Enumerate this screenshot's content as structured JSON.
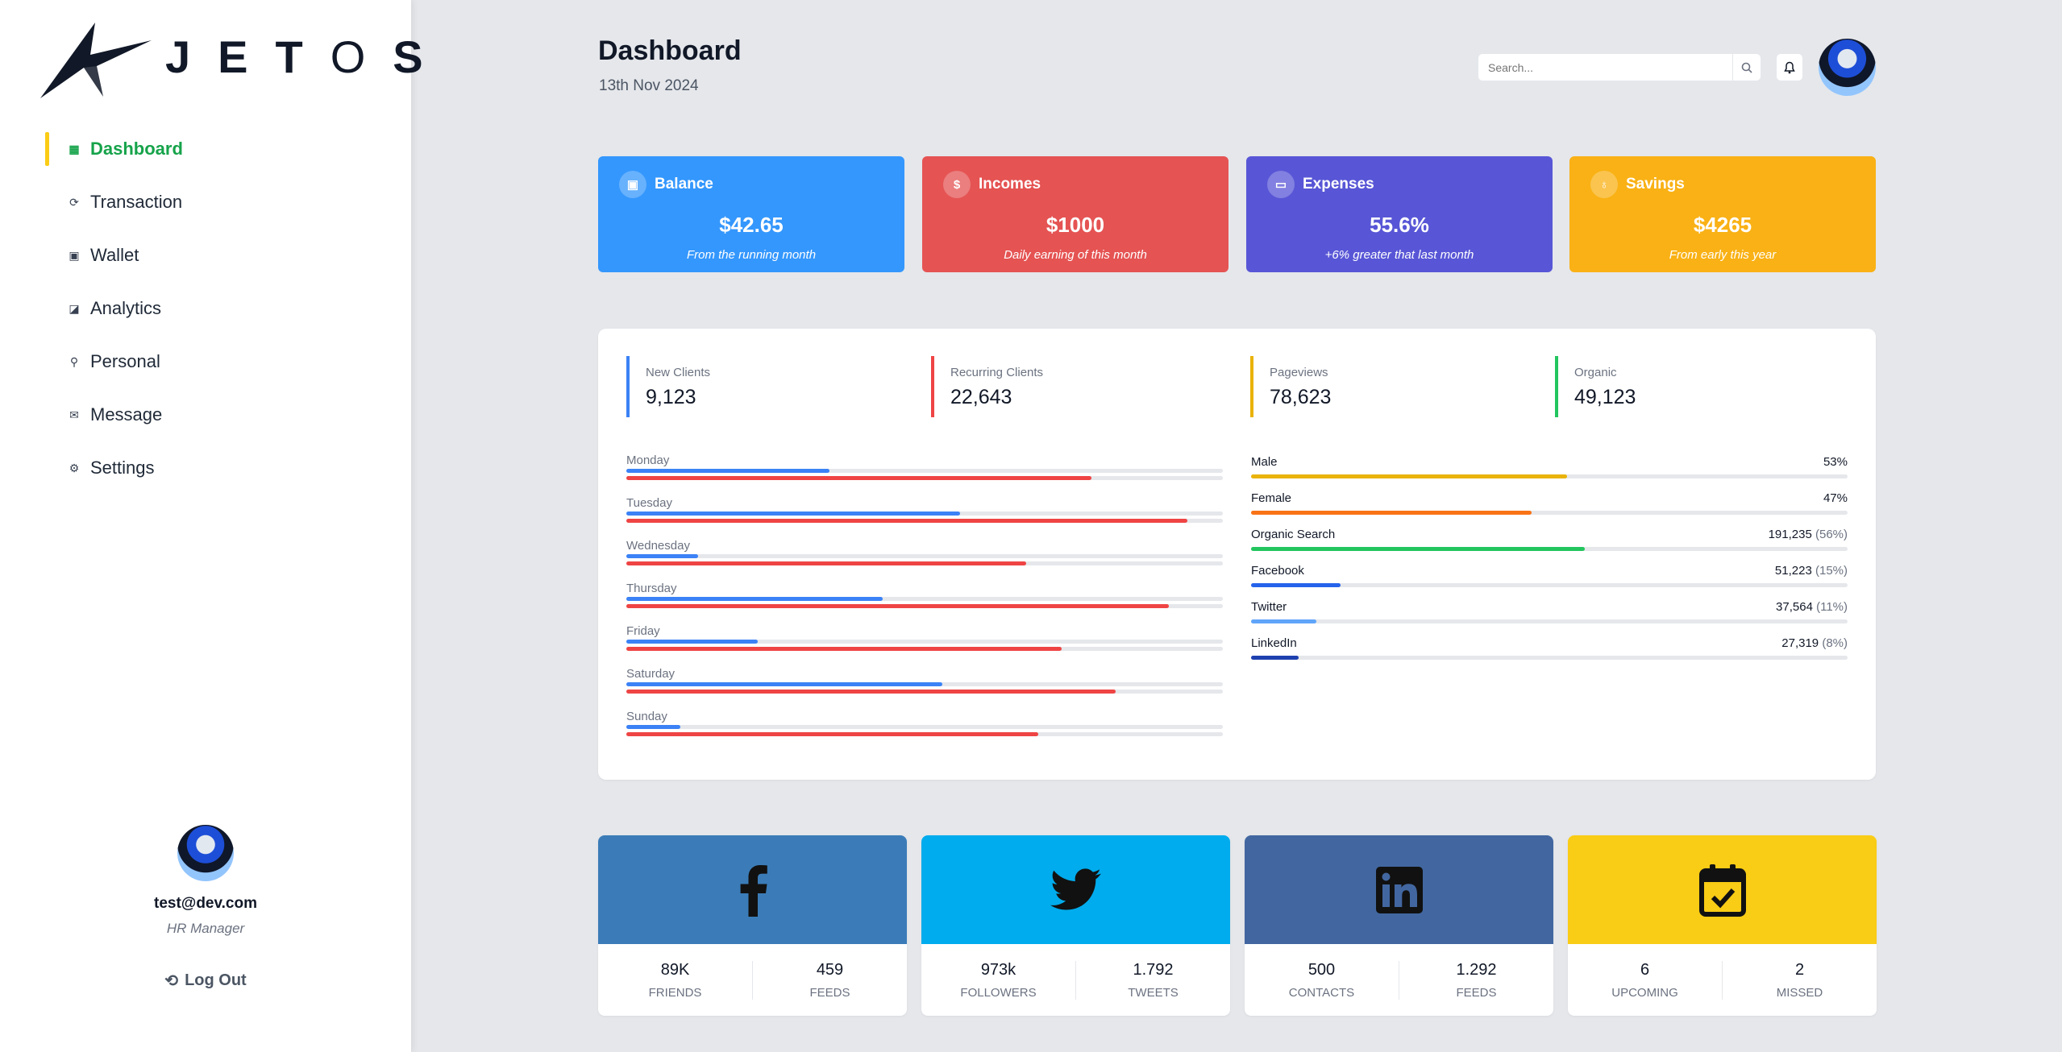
{
  "brand": {
    "name_start": "JET",
    "name_o": "O",
    "name_end": "S"
  },
  "colors": {
    "accent": "#16a34a",
    "active_indicator": "#facc15"
  },
  "sidebar": {
    "items": [
      {
        "label": "Dashboard",
        "icon": "grid-icon"
      },
      {
        "label": "Transaction",
        "icon": "exchange-icon"
      },
      {
        "label": "Wallet",
        "icon": "wallet-icon"
      },
      {
        "label": "Analytics",
        "icon": "chart-icon"
      },
      {
        "label": "Personal",
        "icon": "user-icon"
      },
      {
        "label": "Message",
        "icon": "mail-icon"
      },
      {
        "label": "Settings",
        "icon": "gear-icon"
      }
    ],
    "active": "Dashboard"
  },
  "profile": {
    "email": "test@dev.com",
    "role": "HR Manager",
    "logout": "Log Out"
  },
  "header": {
    "title": "Dashboard",
    "date": "13th Nov 2024",
    "search_placeholder": "Search..."
  },
  "stats": [
    {
      "title": "Balance",
      "value": "$42.65",
      "sub": "From the running month",
      "color": "#3497fd",
      "icon": "wallet-icon"
    },
    {
      "title": "Incomes",
      "value": "$1000",
      "sub": "Daily earning of this month",
      "color": "#e55353",
      "icon": "money-icon"
    },
    {
      "title": "Expenses",
      "value": "55.6%",
      "sub": "+6% greater that last month",
      "color": "#5856d6",
      "icon": "card-icon"
    },
    {
      "title": "Savings",
      "value": "$4265",
      "sub": "From early this year",
      "color": "#f9b115",
      "icon": "piggy-bank-icon"
    }
  ],
  "kpis": [
    {
      "label": "New Clients",
      "value": "9,123",
      "color": "#3b82f6"
    },
    {
      "label": "Recurring Clients",
      "value": "22,643",
      "color": "#ef4444"
    },
    {
      "label": "Pageviews",
      "value": "78,623",
      "color": "#eab308"
    },
    {
      "label": "Organic",
      "value": "49,123",
      "color": "#22c55e"
    }
  ],
  "days": [
    {
      "label": "Monday",
      "blue": 0.34,
      "red": 0.78
    },
    {
      "label": "Tuesday",
      "blue": 0.56,
      "red": 0.94
    },
    {
      "label": "Wednesday",
      "blue": 0.12,
      "red": 0.67
    },
    {
      "label": "Thursday",
      "blue": 0.43,
      "red": 0.91
    },
    {
      "label": "Friday",
      "blue": 0.22,
      "red": 0.73
    },
    {
      "label": "Saturday",
      "blue": 0.53,
      "red": 0.82
    },
    {
      "label": "Sunday",
      "blue": 0.09,
      "red": 0.69
    }
  ],
  "metrics": [
    {
      "label": "Male",
      "value": "53%",
      "pct": "",
      "fill": 0.53,
      "color": "#eab308"
    },
    {
      "label": "Female",
      "value": "47%",
      "pct": "",
      "fill": 0.47,
      "color": "#f97316"
    },
    {
      "label": "Organic Search",
      "value": "191,235",
      "pct": "(56%)",
      "fill": 0.56,
      "color": "#22c55e"
    },
    {
      "label": "Facebook",
      "value": "51,223",
      "pct": "(15%)",
      "fill": 0.15,
      "color": "#2563eb"
    },
    {
      "label": "Twitter",
      "value": "37,564",
      "pct": "(11%)",
      "fill": 0.11,
      "color": "#60a5fa"
    },
    {
      "label": "LinkedIn",
      "value": "27,319",
      "pct": "(8%)",
      "fill": 0.08,
      "color": "#1e40af"
    }
  ],
  "social": [
    {
      "name": "facebook",
      "color": "#3b7cb8",
      "a_num": "89K",
      "a_label": "FRIENDS",
      "b_num": "459",
      "b_label": "FEEDS"
    },
    {
      "name": "twitter",
      "color": "#00aced",
      "a_num": "973k",
      "a_label": "FOLLOWERS",
      "b_num": "1.792",
      "b_label": "TWEETS"
    },
    {
      "name": "linkedin",
      "color": "#4267a0",
      "a_num": "500",
      "a_label": "CONTACTS",
      "b_num": "1.292",
      "b_label": "FEEDS"
    },
    {
      "name": "calendar",
      "color": "#f9cc15",
      "a_num": "6",
      "a_label": "UPCOMING",
      "b_num": "2",
      "b_label": "MISSED"
    }
  ]
}
